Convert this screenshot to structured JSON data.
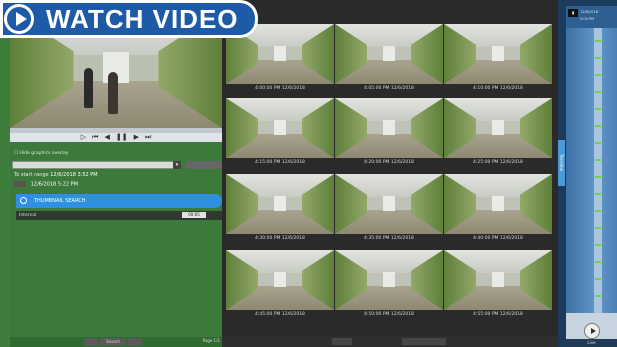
{
  "overlay": {
    "watch_label": "WATCH VIDEO"
  },
  "left_panel": {
    "graphics_label": "Hide graphics overlay",
    "go_label": "Go",
    "from_label": "To start range",
    "from_date": "12/6/2018",
    "from_time": "3:52 PM",
    "to_date": "12/6/2018",
    "to_time": "5:22 PM",
    "thumbnail_search_label": "THUMBNAIL SEARCH",
    "interval_label": "Interval",
    "interval_value": "00:05",
    "footer_button": "Search",
    "page_label": "Page 1/1"
  },
  "grid": {
    "timestamps": [
      "4:00:00 PM 12/6/2018",
      "4:05:00 PM 12/6/2018",
      "4:10:00 PM 12/6/2018",
      "4:15:00 PM 12/6/2018",
      "4:20:00 PM 12/6/2018",
      "4:25:00 PM 12/6/2018",
      "4:30:00 PM 12/6/2018",
      "4:35:00 PM 12/6/2018",
      "4:40:00 PM 12/6/2018",
      "4:45:00 PM 12/6/2018",
      "4:50:00 PM 12/6/2018",
      "4:55:00 PM 12/6/2018"
    ]
  },
  "timeline": {
    "side_tab": "Timeline",
    "header_date": "12/6/2018",
    "header_time": "5:04 PM",
    "footer_label": "Live"
  }
}
